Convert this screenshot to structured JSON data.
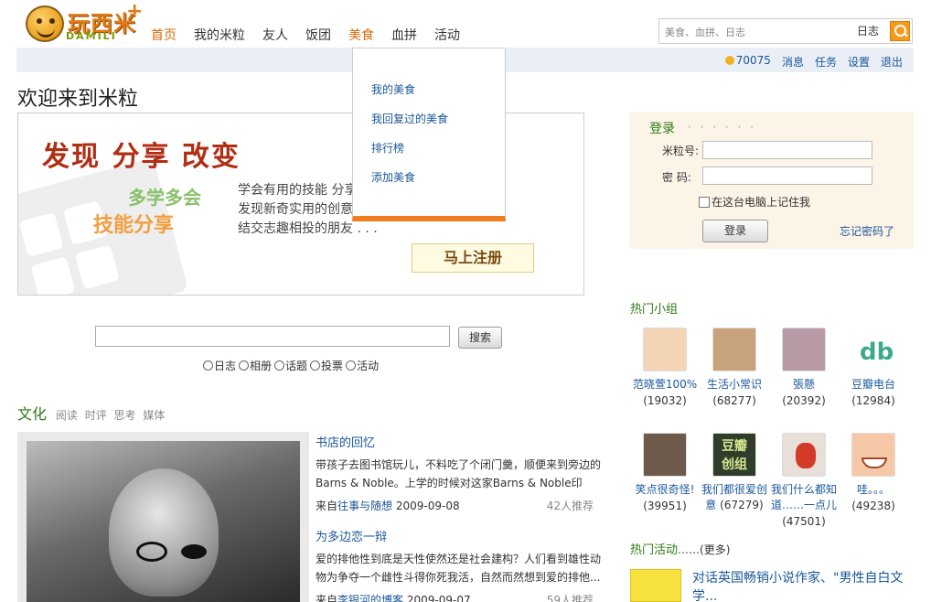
{
  "logo": {
    "text": "玩西米",
    "plus": "+",
    "sub": "DAMILI"
  },
  "nav": {
    "items": [
      "首页",
      "我的米粒",
      "友人",
      "饭团",
      "美食",
      "血拼",
      "活动"
    ],
    "active_index": 0,
    "open_index": 4
  },
  "header_search": {
    "placeholder": "美食、血拼、日志",
    "scope": "日志"
  },
  "userbar": {
    "coins": "70075",
    "messages": "消息",
    "tasks": "任务",
    "settings": "设置",
    "logout": "退出"
  },
  "dropdown": {
    "items": [
      "我的美食",
      "我回复过的美食",
      "排行榜",
      "添加美食"
    ]
  },
  "welcome": {
    "title": "欢迎来到米粒",
    "slogan": "发现 分享 改变",
    "learn": "多学多会",
    "skill": "技能分享",
    "desc": [
      "学会有用的技能 分享",
      "发现新奇实用的创意",
      "结交志趣相投的朋友 . . ."
    ],
    "register": "马上注册"
  },
  "login": {
    "title": "登录",
    "dots": "· · · · · ·",
    "user_label": "米粒号:",
    "pass_label": "密  码:",
    "remember": "在这台电脑上记住我",
    "button": "登录",
    "forgot": "忘记密码了"
  },
  "main_search": {
    "button": "搜索",
    "types": [
      "日志",
      "相册",
      "话题",
      "投票",
      "活动"
    ]
  },
  "culture": {
    "heading": "文化",
    "tags": [
      "阅读",
      "时评",
      "思考",
      "媒体"
    ],
    "articles": [
      {
        "title": "书店的回忆",
        "summary": "带孩子去图书馆玩儿，不料吃了个闭门羹，顺便来到旁边的Barns & Noble。上学的时候对这家Barns & Noble印",
        "from": "来自",
        "source": "往事与随想",
        "date": "2009-09-08",
        "recommends": "42人推荐"
      },
      {
        "title": "为多边恋一辩",
        "summary": "爱的排他性到底是天性使然还是社会建构？人们看到雄性动物为争夺一个雌性斗得你死我活，自然而然想到爱的排他...",
        "from": "来自",
        "source": "李银河的博客",
        "date": "2009-09-07",
        "recommends": "59人推荐"
      }
    ]
  },
  "groups": {
    "title": "热门小组",
    "items": [
      {
        "name": "范晓萱100%",
        "count": "(19032)",
        "color": "#f3d5b5",
        "icon": "person-icon"
      },
      {
        "name": "生活小常识",
        "count": "(68277)",
        "color": "#c8a27a",
        "icon": "portrait-icon"
      },
      {
        "name": "張懸",
        "count": "(20392)",
        "color": "#b89aa6",
        "icon": "photo-icon"
      },
      {
        "name": "豆瓣电台",
        "count": "(12984)",
        "color": "#ffffff",
        "icon": "radio-logo-icon"
      },
      {
        "name": "笑点很奇怪!",
        "count": "(39951)",
        "color": "#6e5a4a",
        "icon": "person-icon"
      },
      {
        "name": "我们都很爱创意",
        "count": "(67279)",
        "color": "#2f3d2a",
        "icon": "group-logo-icon",
        "logo_text": "豆瓣创组"
      },
      {
        "name": "我们什么都知道……一点儿",
        "count": "(47501)",
        "color": "#e8e0d8",
        "icon": "toy-icon"
      },
      {
        "name": "哇。。。",
        "count": "(49238)",
        "color": "#f6c8a8",
        "icon": "smile-icon"
      }
    ]
  },
  "events": {
    "title": "热门活动",
    "more_prefix": "……",
    "more": "(更多)",
    "first": "对话英国畅销小说作家、\"男性自白文学..."
  }
}
